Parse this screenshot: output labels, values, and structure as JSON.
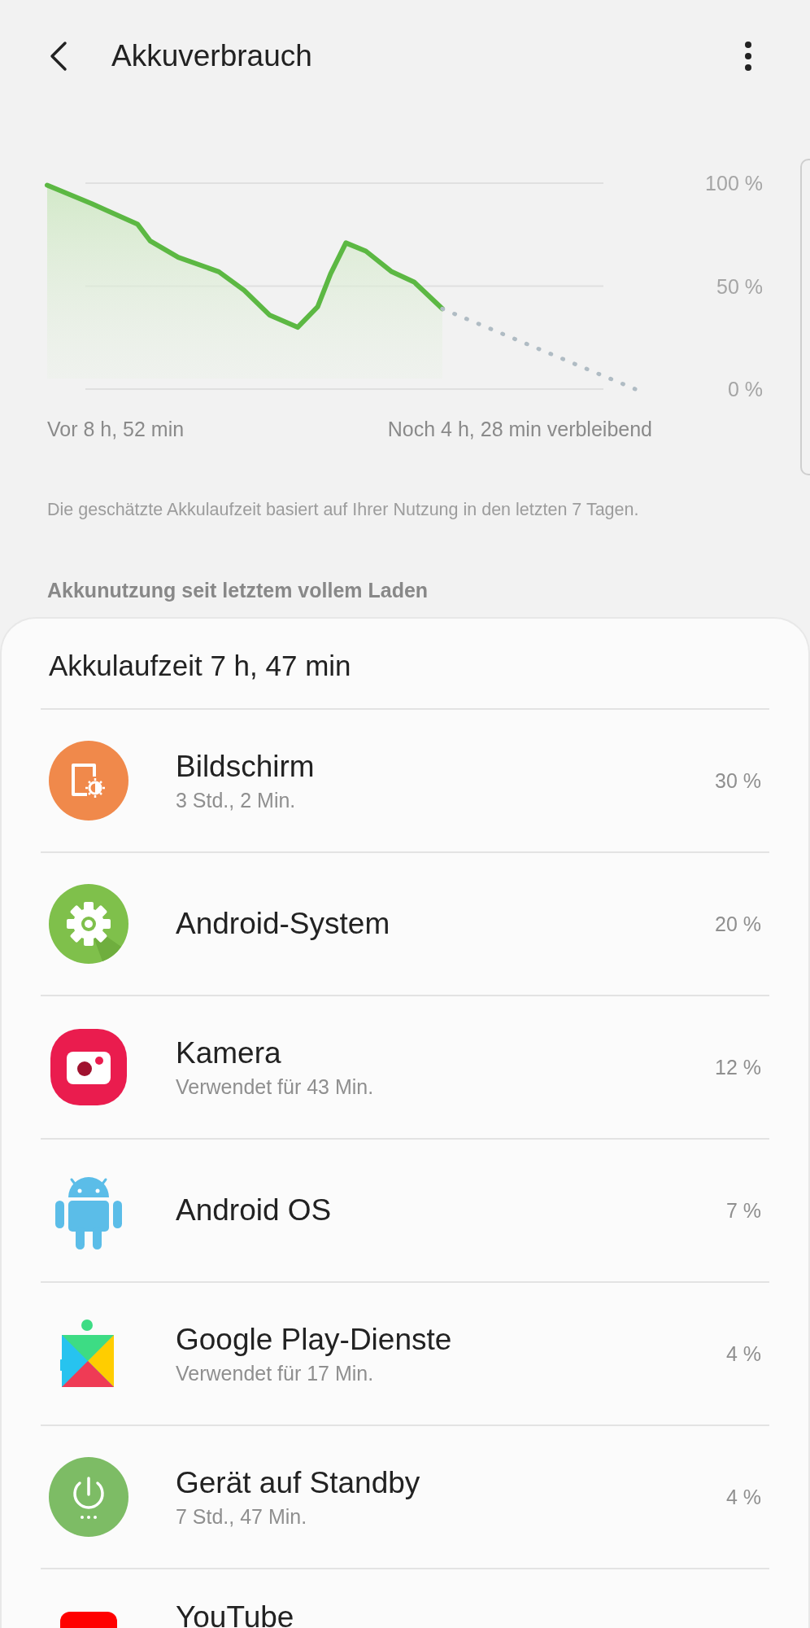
{
  "app_bar": {
    "title": "Akkuverbrauch"
  },
  "chart": {
    "y_labels": [
      "100 %",
      "50 %",
      "0 %"
    ],
    "start_label": "Vor 8 h, 52 min",
    "end_label": "Noch 4 h, 28 min verbleibend"
  },
  "note": "Die geschätzte Akkulaufzeit basiert auf Ihrer Nutzung in den letzten 7 Tagen.",
  "section_header": "Akkunutzung seit letztem vollem Laden",
  "usage": {
    "title": "Akkulaufzeit 7 h, 47 min",
    "items": [
      {
        "kind": "screen",
        "name": "Bildschirm",
        "detail": "3 Std., 2 Min.",
        "percent": "30 %"
      },
      {
        "kind": "system",
        "name": "Android-System",
        "percent": "20 %"
      },
      {
        "kind": "camera",
        "name": "Kamera",
        "detail": "Verwendet für 43 Min.",
        "percent": "12 %"
      },
      {
        "kind": "android",
        "name": "Android OS",
        "percent": "7 %"
      },
      {
        "kind": "play",
        "name": "Google Play-Dienste",
        "detail": "Verwendet für 17 Min.",
        "percent": "4 %"
      },
      {
        "kind": "standby",
        "name": "Gerät auf Standby",
        "detail": "7 Std., 47 Min.",
        "percent": "4 %"
      },
      {
        "kind": "youtube",
        "name": "YouTube"
      }
    ]
  }
}
